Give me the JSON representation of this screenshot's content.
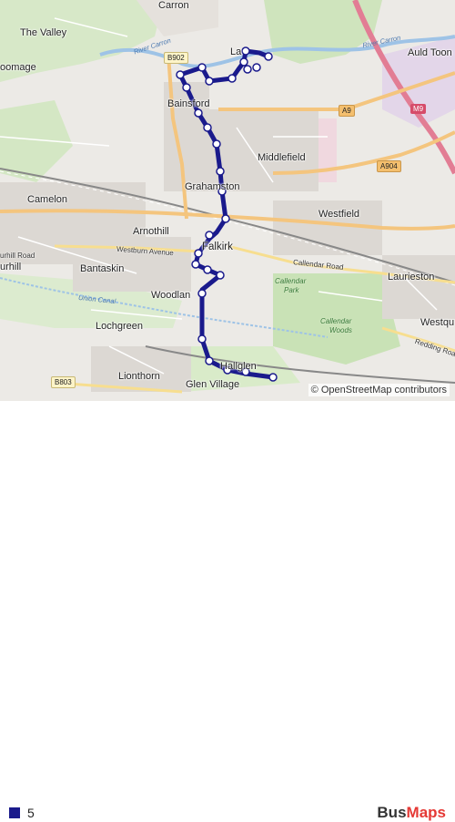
{
  "map": {
    "places": {
      "carron": "Carron",
      "the_valley": "The Valley",
      "stenhousemuir_part": "oomage",
      "larbert_part": "La",
      "auld_toon": "Auld Toon",
      "bainsford": "Bainsford",
      "middlefield": "Middlefield",
      "camelon": "Camelon",
      "grahamston": "Grahamston",
      "westfield": "Westfield",
      "arnothill": "Arnothill",
      "falkirk": "Falkirk",
      "hallglen_part": "urhill",
      "bantaskin": "Bantaskin",
      "laurieston": "Laurieston",
      "woodlands": "Woodlan",
      "westquarter": "Westqu",
      "lochgreen": "Lochgreen",
      "lionthorn": "Lionthorn",
      "hallglen": "Hallglen",
      "glen_village": "Glen Village",
      "tamfourhill": "urhill Road"
    },
    "streets": {
      "westburn_avenue": "Westburn Avenue",
      "callendar_road": "Callendar Road",
      "redding_road": "Redding Roa",
      "union_canal": "Union Canal"
    },
    "parks": {
      "callendar_park_1": "Callendar",
      "callendar_park_2": "Park",
      "callendar_woods_1": "Callendar",
      "callendar_woods_2": "Woods"
    },
    "rivers": {
      "river_carron_west": "River Carron",
      "river_carron_east": "River Carron"
    },
    "shields": {
      "b902": "B902",
      "a9": "A9",
      "m9": "M9",
      "a904": "A904",
      "b803": "B803"
    },
    "attribution": "© OpenStreetMap contributors"
  },
  "route_color": "#1a1a8c",
  "legend": {
    "route_label": "5"
  },
  "brand": {
    "bus": "Bus",
    "maps": "Maps"
  }
}
